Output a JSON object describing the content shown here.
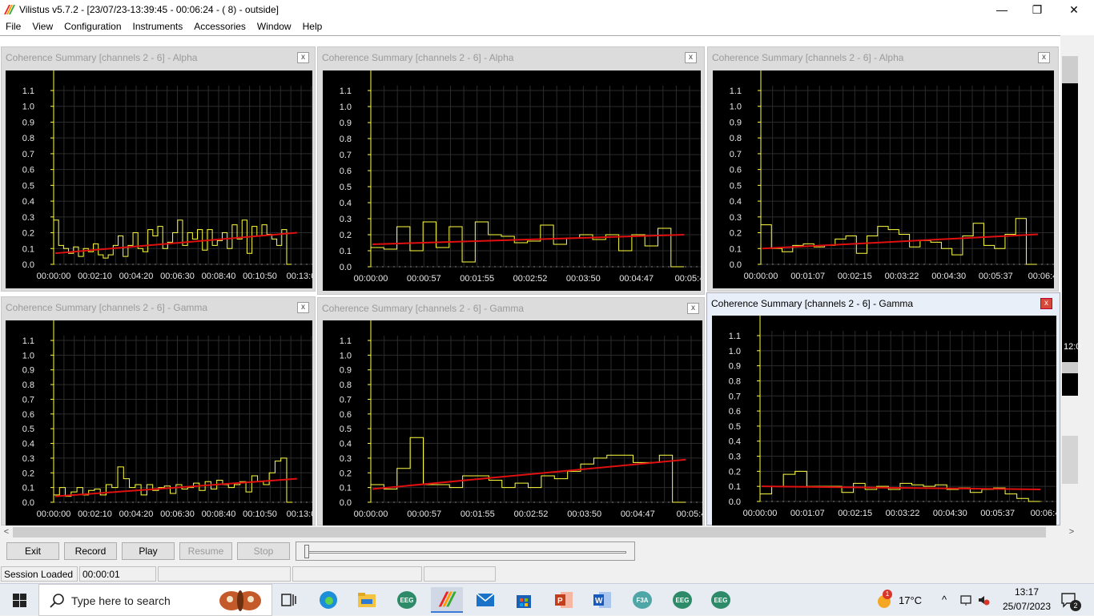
{
  "window": {
    "title": "Vilistus v5.7.2 - [23/07/23-13:39:45 - 00:06:24 - ( 8) - outside]",
    "min_glyph": "—",
    "max_glyph": "❐",
    "close_glyph": "✕"
  },
  "menu": [
    "File",
    "View",
    "Configuration",
    "Instruments",
    "Accessories",
    "Window",
    "Help"
  ],
  "panels": [
    {
      "title": "Coherence Summary [channels 2 - 6] - Alpha",
      "close": "x",
      "y_ticks": [
        "1.1",
        "1.0",
        "0.9",
        "0.8",
        "0.7",
        "0.6",
        "0.5",
        "0.4",
        "0.3",
        "0.2",
        "0.1",
        "0.0"
      ],
      "x_ticks": [
        "00:00:00",
        "00:02:10",
        "00:04:20",
        "00:06:30",
        "00:08:40",
        "00:10:50",
        "00:13:0"
      ],
      "values": [
        0.28,
        0.12,
        0.1,
        0.07,
        0.11,
        0.05,
        0.1,
        0.08,
        0.13,
        0.06,
        0.04,
        0.06,
        0.12,
        0.18,
        0.05,
        0.12,
        0.2,
        0.1,
        0.08,
        0.22,
        0.18,
        0.24,
        0.1,
        0.14,
        0.2,
        0.28,
        0.12,
        0.2,
        0.16,
        0.22,
        0.09,
        0.22,
        0.12,
        0.15,
        0.2,
        0.1,
        0.25,
        0.16,
        0.28,
        0.07,
        0.24,
        0.18,
        0.25,
        0.19,
        0.16,
        0.12,
        0.22,
        0.0
      ],
      "trend": [
        0.07,
        0.2
      ]
    },
    {
      "title": "Coherence Summary [channels 2 - 6] - Alpha",
      "close": "x",
      "y_ticks": [
        "1.1",
        "1.0",
        "0.9",
        "0.8",
        "0.7",
        "0.6",
        "0.5",
        "0.4",
        "0.3",
        "0.2",
        "0.1",
        "0.0"
      ],
      "x_ticks": [
        "00:00:00",
        "00:00:57",
        "00:01:55",
        "00:02:52",
        "00:03:50",
        "00:04:47",
        "00:05:4"
      ],
      "values": [
        0.12,
        0.11,
        0.25,
        0.1,
        0.28,
        0.12,
        0.25,
        0.03,
        0.28,
        0.2,
        0.19,
        0.15,
        0.16,
        0.26,
        0.14,
        0.18,
        0.2,
        0.17,
        0.2,
        0.1,
        0.2,
        0.13,
        0.24,
        0.0
      ],
      "trend": [
        0.14,
        0.2
      ]
    },
    {
      "title": "Coherence Summary [channels 2 - 6] - Alpha",
      "close": "x",
      "y_ticks": [
        "1.1",
        "1.0",
        "0.9",
        "0.8",
        "0.7",
        "0.6",
        "0.5",
        "0.4",
        "0.3",
        "0.2",
        "0.1",
        "0.0"
      ],
      "x_ticks": [
        "00:00:00",
        "00:01:07",
        "00:02:15",
        "00:03:22",
        "00:04:30",
        "00:05:37",
        "00:06:4"
      ],
      "values": [
        0.25,
        0.1,
        0.08,
        0.12,
        0.13,
        0.11,
        0.12,
        0.16,
        0.18,
        0.07,
        0.18,
        0.24,
        0.22,
        0.19,
        0.11,
        0.15,
        0.14,
        0.1,
        0.06,
        0.18,
        0.26,
        0.12,
        0.1,
        0.19,
        0.29,
        0.0
      ],
      "trend": [
        0.1,
        0.19
      ]
    },
    {
      "title": "Coherence Summary [channels 2 - 6] - Gamma",
      "close": "x",
      "y_ticks": [
        "1.1",
        "1.0",
        "0.9",
        "0.8",
        "0.7",
        "0.6",
        "0.5",
        "0.4",
        "0.3",
        "0.2",
        "0.1",
        "0.0"
      ],
      "x_ticks": [
        "00:00:00",
        "00:02:10",
        "00:04:20",
        "00:06:30",
        "00:08:40",
        "00:10:50",
        "00:13:0"
      ],
      "values": [
        0.05,
        0.1,
        0.04,
        0.07,
        0.1,
        0.05,
        0.08,
        0.09,
        0.05,
        0.12,
        0.1,
        0.24,
        0.16,
        0.1,
        0.12,
        0.05,
        0.12,
        0.08,
        0.1,
        0.11,
        0.06,
        0.12,
        0.09,
        0.1,
        0.13,
        0.08,
        0.14,
        0.09,
        0.15,
        0.12,
        0.1,
        0.12,
        0.14,
        0.07,
        0.18,
        0.14,
        0.12,
        0.2,
        0.28,
        0.3,
        0.0
      ],
      "trend": [
        0.04,
        0.16
      ]
    },
    {
      "title": "Coherence Summary [channels 2 - 6] - Gamma",
      "close": "x",
      "y_ticks": [
        "1.1",
        "1.0",
        "0.9",
        "0.8",
        "0.7",
        "0.6",
        "0.5",
        "0.4",
        "0.3",
        "0.2",
        "0.1",
        "0.0"
      ],
      "x_ticks": [
        "00:00:00",
        "00:00:57",
        "00:01:55",
        "00:02:52",
        "00:03:50",
        "00:04:47",
        "00:05:4"
      ],
      "values": [
        0.12,
        0.09,
        0.23,
        0.44,
        0.12,
        0.12,
        0.1,
        0.18,
        0.18,
        0.15,
        0.1,
        0.13,
        0.1,
        0.18,
        0.16,
        0.21,
        0.26,
        0.3,
        0.32,
        0.32,
        0.27,
        0.27,
        0.32,
        0.0
      ],
      "trend": [
        0.09,
        0.29
      ]
    },
    {
      "title": "Coherence Summary [channels 2 - 6] - Gamma",
      "close": "x",
      "y_ticks": [
        "1.1",
        "1.0",
        "0.9",
        "0.8",
        "0.7",
        "0.6",
        "0.5",
        "0.4",
        "0.3",
        "0.2",
        "0.1",
        "0.0"
      ],
      "x_ticks": [
        "00:00:00",
        "00:01:07",
        "00:02:15",
        "00:03:22",
        "00:04:30",
        "00:05:37",
        "00:06:4"
      ],
      "values": [
        0.05,
        0.1,
        0.18,
        0.2,
        0.1,
        0.1,
        0.1,
        0.06,
        0.12,
        0.08,
        0.1,
        0.08,
        0.12,
        0.11,
        0.1,
        0.11,
        0.08,
        0.09,
        0.06,
        0.08,
        0.09,
        0.05,
        0.02,
        0.0
      ],
      "trend": [
        0.1,
        0.08
      ]
    }
  ],
  "scroll": {
    "left": "<",
    "right": ">"
  },
  "vscroll_clock": "12:0",
  "toolbar": {
    "exit": "Exit",
    "record": "Record",
    "play": "Play",
    "resume": "Resume",
    "stop": "Stop"
  },
  "status": {
    "state": "Session Loaded",
    "time": "00:00:01"
  },
  "taskbar": {
    "search_placeholder": "Type here to search",
    "eeg_label": "EEG",
    "f3a_label": "F3A",
    "weather_temp": "17°C",
    "weather_badge": "1",
    "clock_time": "13:17",
    "clock_date": "25/07/2023",
    "notif_count": "2",
    "tray_arrow": "^"
  },
  "colors": {
    "trace": "#ffff40",
    "trend": "#e01010",
    "grid": "#2c2c2c",
    "axis": "#ffff40"
  }
}
